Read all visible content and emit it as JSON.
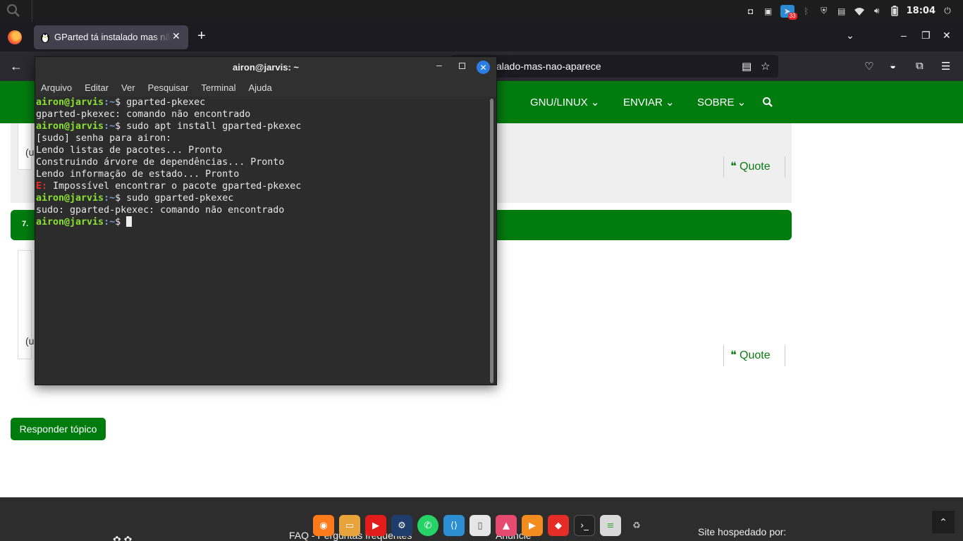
{
  "system_panel": {
    "clock": "18:04",
    "telegram_badge": "33",
    "tray_icons": [
      "camera-icon",
      "radio-icon",
      "telegram-icon",
      "bluetooth-icon",
      "shield-icon",
      "clipboard-icon",
      "wifi-icon",
      "volume-icon",
      "battery-icon",
      "power-icon"
    ]
  },
  "browser": {
    "tab_title": "GParted tá instalado mas não aparece",
    "tab_close": "✕",
    "new_tab": "+",
    "url_visible": "alado-mas-nao-aparece",
    "window_controls": {
      "minimize": "–",
      "restore": "❐",
      "close": "✕"
    }
  },
  "site": {
    "menu": [
      {
        "label": "GNU/LINUX ⌄"
      },
      {
        "label": "ENVIAR ⌄"
      },
      {
        "label": "SOBRE ⌄"
      }
    ],
    "quote_label": "❝ Quote",
    "post_number": "7. ",
    "user_label_partial": "(u",
    "reply_button": "Responder tópico",
    "footer": {
      "faq": "FAQ - Perguntas frequentes",
      "anuncie": "Anuncie",
      "hosted": "Site hospedado por:"
    }
  },
  "terminal": {
    "title": "airon@jarvis: ~",
    "menu": [
      "Arquivo",
      "Editar",
      "Ver",
      "Pesquisar",
      "Terminal",
      "Ajuda"
    ],
    "prompt_user": "airon@jarvis",
    "prompt_sep": ":~$ ",
    "lines": {
      "cmd1": "gparted-pkexec",
      "out1": "gparted-pkexec: comando não encontrado",
      "cmd2": "sudo apt install gparted-pkexec",
      "out2": "[sudo] senha para airon:",
      "out3": "Lendo listas de pacotes... Pronto",
      "out4": "Construindo árvore de dependências... Pronto",
      "out5": "Lendo informação de estado... Pronto",
      "err_tag": "E:",
      "err_msg": " Impossível encontrar o pacote gparted-pkexec",
      "cmd3": "sudo gparted-pkexec",
      "out6": "sudo: gparted-pkexec: comando não encontrado"
    }
  },
  "dock_apps": [
    "firefox-icon",
    "files-icon",
    "youtube-icon",
    "steam-icon",
    "whatsapp-icon",
    "vscode-icon",
    "document-icon",
    "image-viewer-icon",
    "media-player-icon",
    "anydesk-icon",
    "terminal-icon",
    "settings-icon",
    "trash-icon"
  ]
}
